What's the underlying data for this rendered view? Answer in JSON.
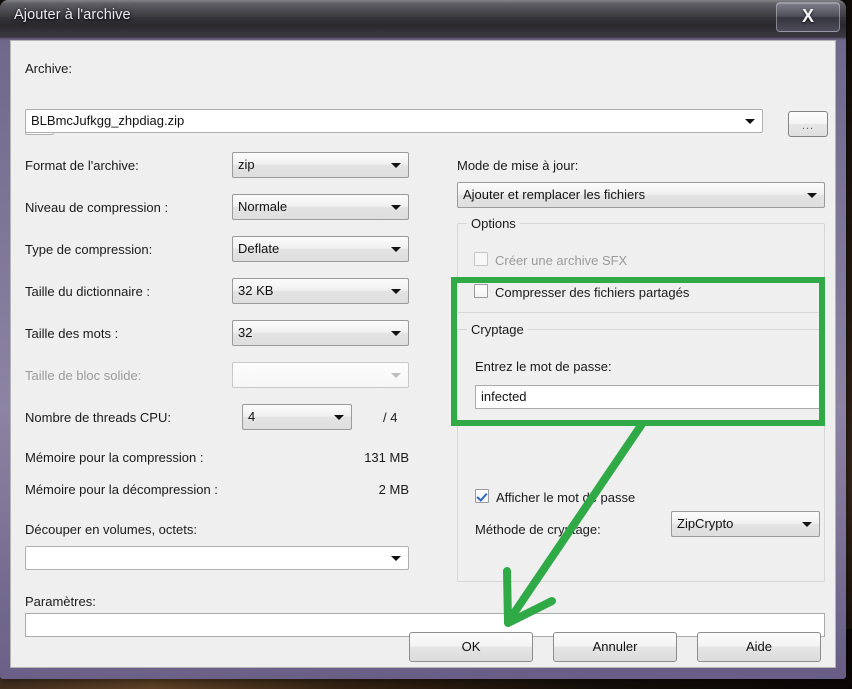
{
  "window": {
    "title": "Ajouter à l'archive",
    "close_label": "X",
    "close_icon": "close-icon"
  },
  "archive": {
    "label": "Archive:",
    "value": "BLBmcJufkgg_zhpdiag.zip",
    "browse_label": "..."
  },
  "left_panel": {
    "format": {
      "label": "Format de l'archive:",
      "value": "zip"
    },
    "compression_level": {
      "label": "Niveau de compression :",
      "value": "Normale"
    },
    "compression_type": {
      "label": "Type de compression:",
      "value": "Deflate"
    },
    "dictionary_size": {
      "label": "Taille du dictionnaire :",
      "value": "32 KB"
    },
    "word_size": {
      "label": "Taille des mots :",
      "value": "32"
    },
    "solid_block_size": {
      "label": "Taille de bloc solide:",
      "value": ""
    },
    "cpu_threads": {
      "label": "Nombre de threads CPU:",
      "value": "4",
      "max": "/ 4"
    },
    "memory_compress": {
      "label": "Mémoire pour la compression :",
      "value": "131 MB"
    },
    "memory_decompress": {
      "label": "Mémoire pour la décompression :",
      "value": "2 MB"
    },
    "split_volumes": {
      "label": "Découper en volumes, octets:",
      "value": ""
    },
    "parameters": {
      "label": "Paramètres:",
      "value": ""
    }
  },
  "right_panel": {
    "update_mode": {
      "label": "Mode de mise à jour:",
      "value": "Ajouter et remplacer les fichiers"
    },
    "options": {
      "title": "Options",
      "sfx": {
        "label": "Créer une archive SFX",
        "checked": false,
        "enabled": false
      },
      "shared_files": {
        "label": "Compresser des fichiers partagés",
        "checked": false,
        "enabled": true
      }
    },
    "encryption": {
      "title": "Cryptage",
      "password_label": "Entrez le mot de passe:",
      "password_value": "infected",
      "show_password": {
        "label": "Afficher le mot de passe",
        "checked": true
      },
      "method": {
        "label": "Méthode de cryptage:",
        "value": "ZipCrypto"
      }
    }
  },
  "buttons": {
    "ok": "OK",
    "cancel": "Annuler",
    "help": "Aide"
  },
  "annotation": {
    "color": "#2faa47",
    "highlight_target": "cryptage-group",
    "arrow_target": "ok-button"
  }
}
